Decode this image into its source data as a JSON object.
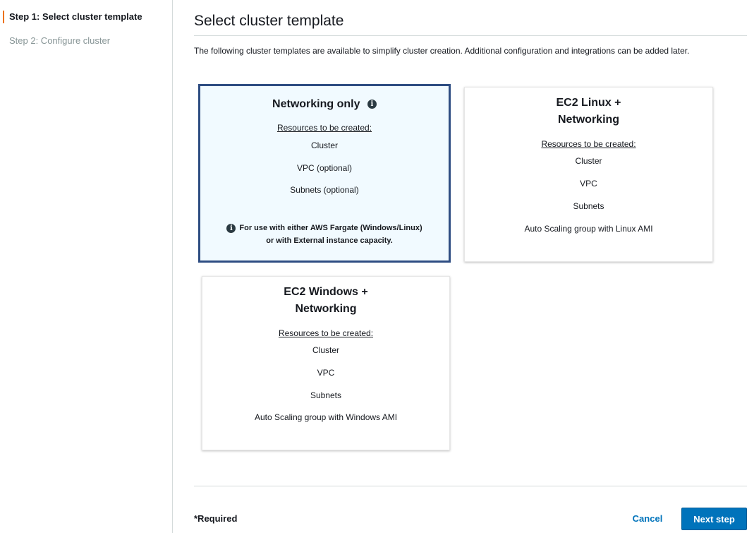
{
  "steps": [
    {
      "label": "Step 1: Select cluster template",
      "active": true
    },
    {
      "label": "Step 2: Configure cluster",
      "active": false
    }
  ],
  "main": {
    "title": "Select cluster template",
    "description": "The following cluster templates are available to simplify cluster creation. Additional configuration and integrations can be added later."
  },
  "cards": {
    "networking": {
      "title": "Networking only",
      "subhead": "Resources to be created:",
      "items": [
        "Cluster",
        "VPC (optional)",
        "Subnets (optional)"
      ],
      "note_line1": "For use with either AWS Fargate (Windows/Linux)",
      "note_line2": "or with External instance capacity.",
      "selected": true
    },
    "linux": {
      "title_line1": "EC2 Linux +",
      "title_line2": "Networking",
      "subhead": "Resources to be created:",
      "items": [
        "Cluster",
        "VPC",
        "Subnets",
        "Auto Scaling group with Linux AMI"
      ],
      "selected": false
    },
    "windows": {
      "title_line1": "EC2 Windows +",
      "title_line2": "Networking",
      "subhead": "Resources to be created:",
      "items": [
        "Cluster",
        "VPC",
        "Subnets",
        "Auto Scaling group with Windows AMI"
      ],
      "selected": false
    }
  },
  "footer": {
    "required_label": "*Required",
    "cancel_label": "Cancel",
    "next_label": "Next step"
  },
  "colors": {
    "accent": "#ec7211",
    "primary_button": "#0073bb",
    "selected_border": "#2e4d82",
    "selected_bg": "#f1faff"
  }
}
